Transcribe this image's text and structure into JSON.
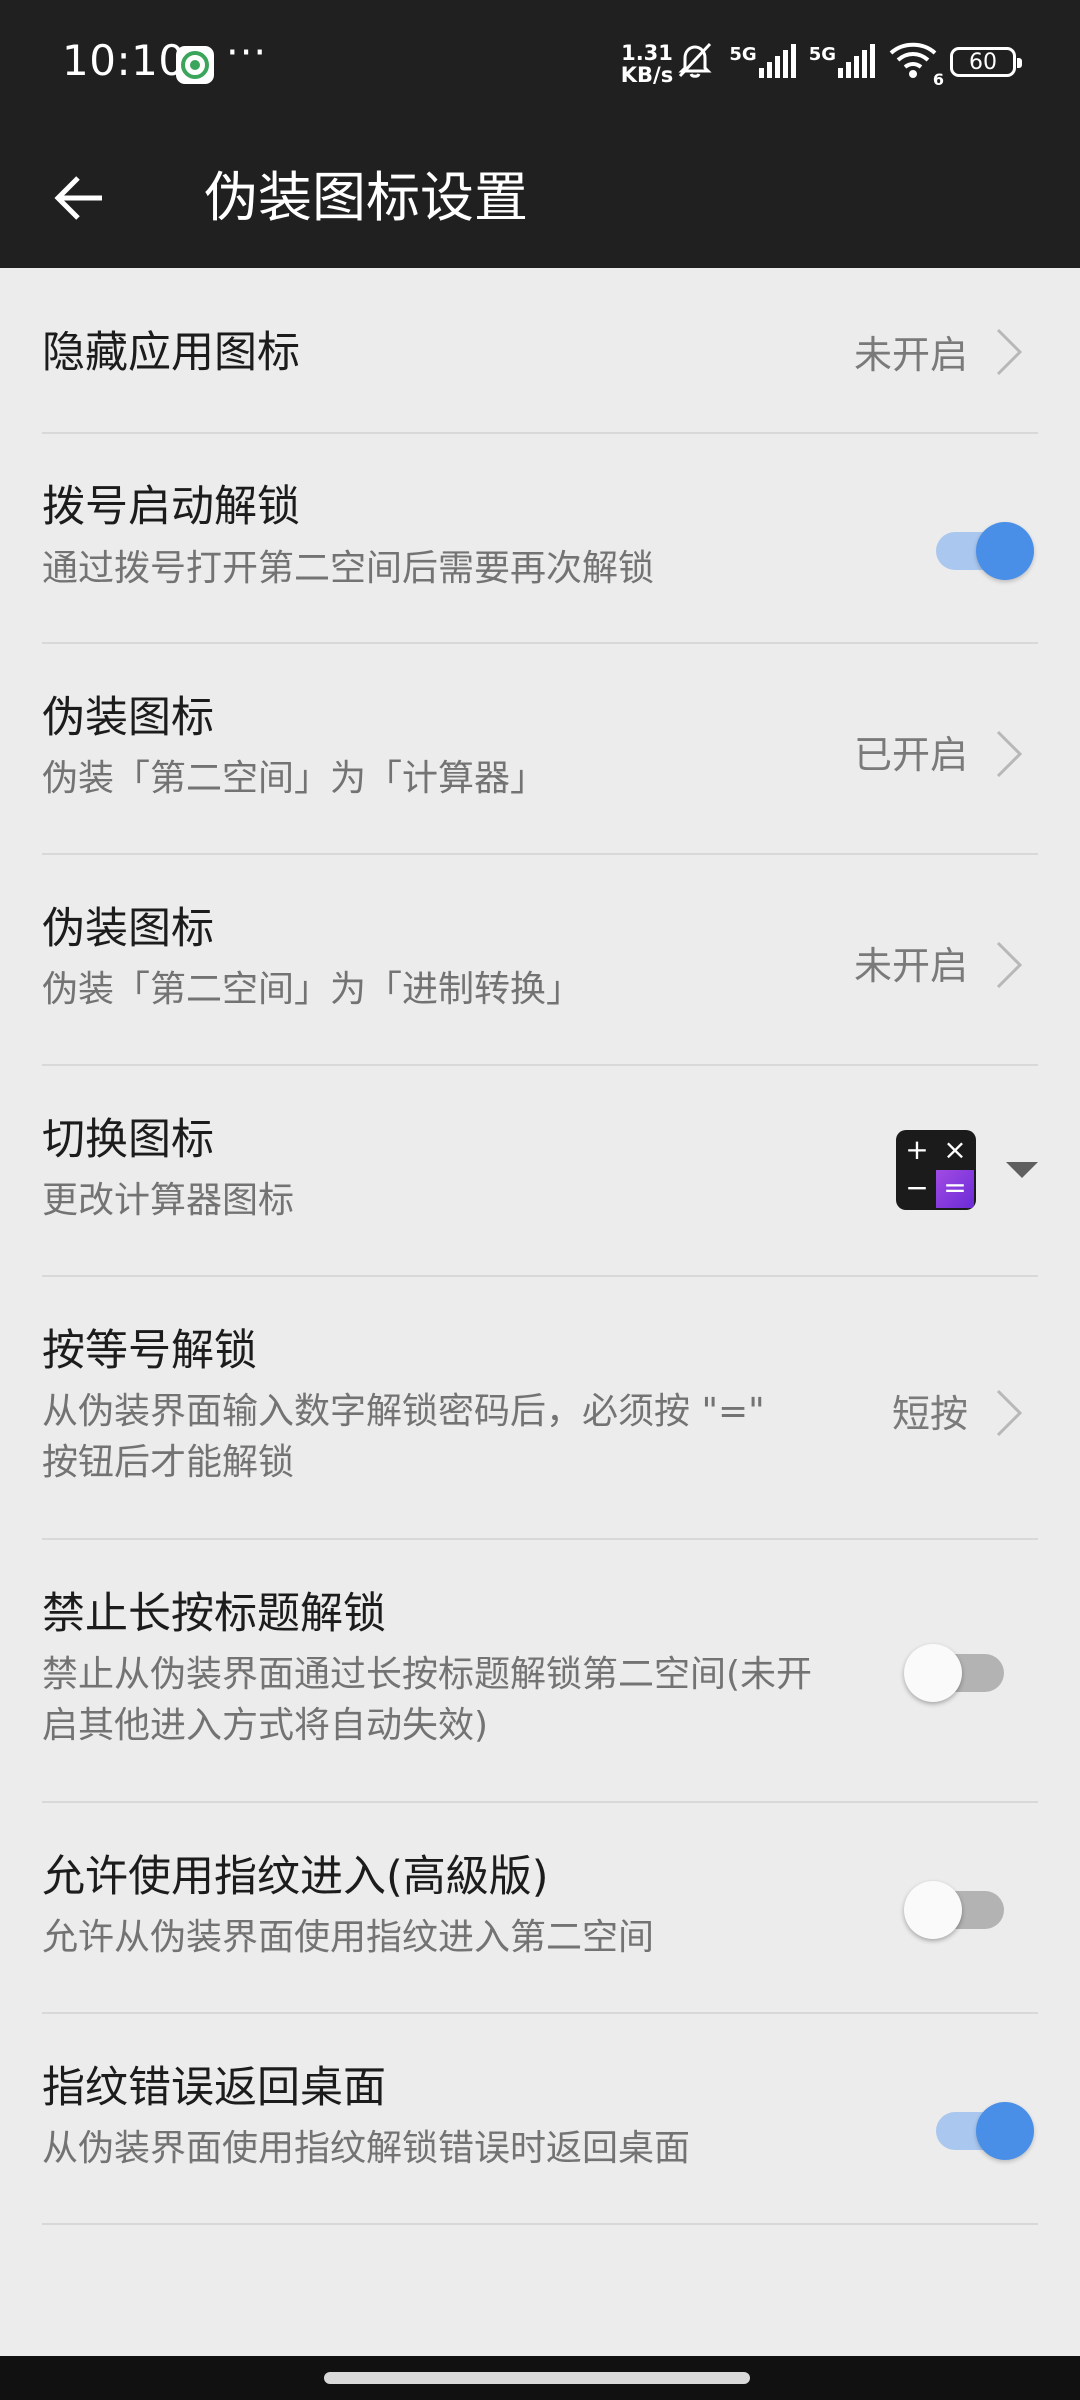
{
  "status_bar": {
    "time": "10:10",
    "more": "···",
    "net_speed_value": "1.31",
    "net_speed_unit": "KB/s",
    "signal1_label": "5G",
    "signal2_label": "5G",
    "wifi_badge": "6",
    "battery": "60"
  },
  "app_bar": {
    "title": "伪装图标设置"
  },
  "rows": {
    "hide_icon": {
      "title": "隐藏应用图标",
      "value": "未开启"
    },
    "dial_unlock": {
      "title": "拨号启动解锁",
      "sub": "通过拨号打开第二空间后需要再次解锁",
      "on": true
    },
    "disguise_calc": {
      "title": "伪装图标",
      "sub": "伪装「第二空间」为「计算器」",
      "value": "已开启"
    },
    "disguise_converter": {
      "title": "伪装图标",
      "sub": "伪装「第二空间」为「进制转换」",
      "value": "未开启"
    },
    "switch_icon": {
      "title": "切换图标",
      "sub": "更改计算器图标",
      "calc_keys": [
        "+",
        "×",
        "−",
        "="
      ]
    },
    "equals_unlock": {
      "title": "按等号解锁",
      "sub_line1": "从伪装界面输入数字解锁密码后，必须按 \"=\"",
      "sub_line2": "按钮后才能解锁",
      "value": "短按"
    },
    "no_long_press": {
      "title": "禁止长按标题解锁",
      "sub_line1": "禁止从伪装界面通过长按标题解锁第二空间(未开",
      "sub_line2": "启其他进入方式将自动失效)",
      "on": false
    },
    "fingerprint": {
      "title": "允许使用指纹进入(高級版)",
      "sub": "允许从伪装界面使用指纹进入第二空间",
      "on": false
    },
    "fp_error_home": {
      "title": "指纹错误返回桌面",
      "sub": "从伪装界面使用指纹解锁错误时返回桌面",
      "on": true
    }
  },
  "colors": {
    "switch_on_knob": "#4a8fe7",
    "switch_on_track": "#a9c7ef",
    "app_bar": "#202020",
    "background": "#ececec"
  }
}
